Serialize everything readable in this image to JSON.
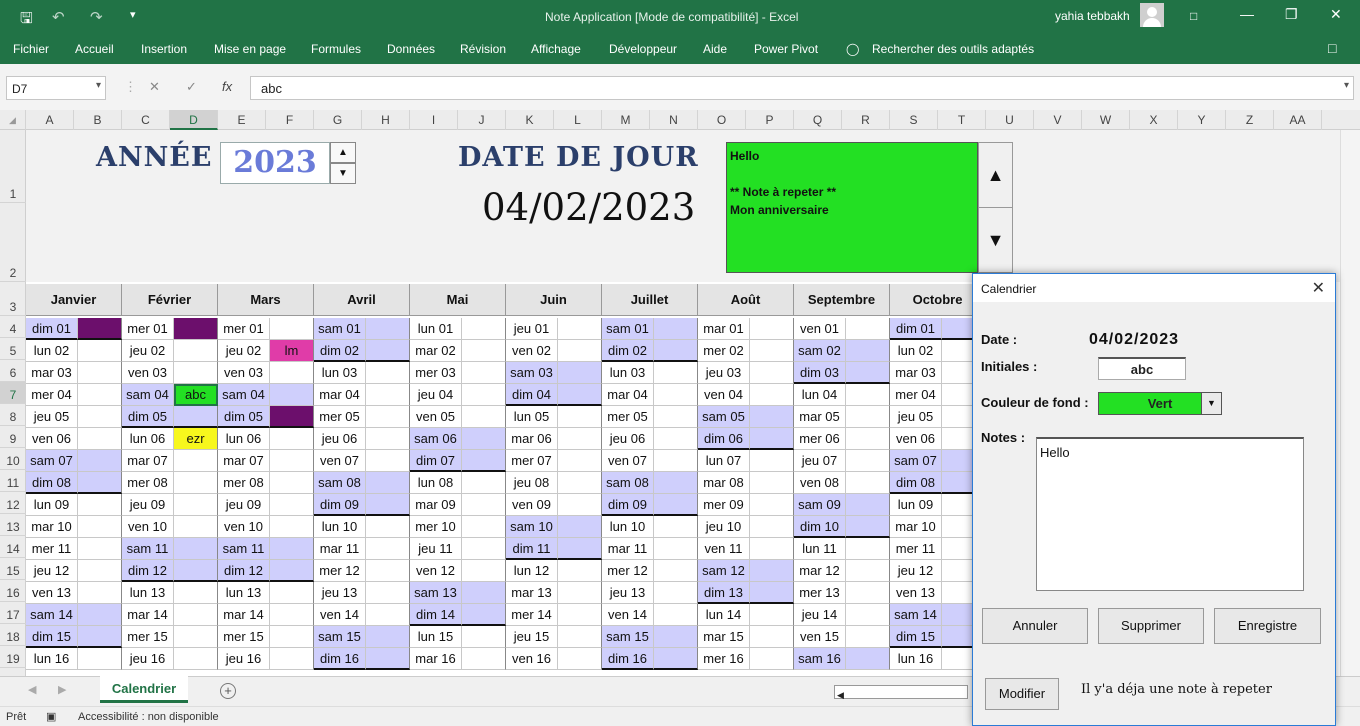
{
  "window": {
    "title": "Note Application  [Mode de compatibilité]  -  Excel",
    "user": "yahia tebbakh"
  },
  "ribbon": {
    "tabs": [
      "Fichier",
      "Accueil",
      "Insertion",
      "Mise en page",
      "Formules",
      "Données",
      "Révision",
      "Affichage",
      "Développeur",
      "Aide",
      "Power Pivot"
    ],
    "search": "Rechercher des outils adaptés"
  },
  "formula_bar": {
    "name_box": "D7",
    "fx": "fx",
    "value": "abc"
  },
  "columns": [
    "A",
    "B",
    "C",
    "D",
    "E",
    "F",
    "G",
    "H",
    "I",
    "J",
    "K",
    "L",
    "M",
    "N",
    "O",
    "P",
    "Q",
    "R",
    "S",
    "T",
    "U",
    "V",
    "W",
    "X",
    "Y",
    "Z",
    "AA"
  ],
  "rows": [
    "1",
    "2",
    "3",
    "4",
    "5",
    "6",
    "7",
    "8",
    "9",
    "10",
    "11",
    "12",
    "13",
    "14",
    "15",
    "16",
    "17",
    "18",
    "19"
  ],
  "header": {
    "annee_label": "ANNÉE",
    "annee_value": "2023",
    "date_label": "DATE DE JOUR",
    "date_value": "04/02/2023",
    "notes_panel": [
      "Hello",
      "",
      "** Note à repeter **",
      "Mon anniversaire"
    ]
  },
  "calendar": {
    "months": [
      "Janvier",
      "Février",
      "Mars",
      "Avril",
      "Mai",
      "Juin",
      "Juillet",
      "Août",
      "Septembre",
      "Octobre"
    ],
    "days": [
      [
        "dim 01",
        "lun 02",
        "mar 03",
        "mer 04",
        "jeu 05",
        "ven 06",
        "sam 07",
        "dim 08",
        "lun 09",
        "mar 10",
        "mer 11",
        "jeu 12",
        "ven 13",
        "sam 14",
        "dim 15",
        "lun 16"
      ],
      [
        "mer 01",
        "jeu 02",
        "ven 03",
        "sam 04",
        "dim 05",
        "lun 06",
        "mar 07",
        "mer 08",
        "jeu 09",
        "ven 10",
        "sam 11",
        "dim 12",
        "lun 13",
        "mar 14",
        "mer 15",
        "jeu 16"
      ],
      [
        "mer 01",
        "jeu 02",
        "ven 03",
        "sam 04",
        "dim 05",
        "lun 06",
        "mar 07",
        "mer 08",
        "jeu 09",
        "ven 10",
        "sam 11",
        "dim 12",
        "lun 13",
        "mar 14",
        "mer 15",
        "jeu 16"
      ],
      [
        "sam 01",
        "dim 02",
        "lun 03",
        "mar 04",
        "mer 05",
        "jeu 06",
        "ven 07",
        "sam 08",
        "dim 09",
        "lun 10",
        "mar 11",
        "mer 12",
        "jeu 13",
        "ven 14",
        "sam 15",
        "dim 16"
      ],
      [
        "lun 01",
        "mar 02",
        "mer 03",
        "jeu 04",
        "ven 05",
        "sam 06",
        "dim 07",
        "lun 08",
        "mar 09",
        "mer 10",
        "jeu 11",
        "ven 12",
        "sam 13",
        "dim 14",
        "lun 15",
        "mar 16"
      ],
      [
        "jeu 01",
        "ven 02",
        "sam 03",
        "dim 04",
        "lun 05",
        "mar 06",
        "mer 07",
        "jeu 08",
        "ven 09",
        "sam 10",
        "dim 11",
        "lun 12",
        "mar 13",
        "mer 14",
        "jeu 15",
        "ven 16"
      ],
      [
        "sam 01",
        "dim 02",
        "lun 03",
        "mar 04",
        "mer 05",
        "jeu 06",
        "ven 07",
        "sam 08",
        "dim 09",
        "lun 10",
        "mar 11",
        "mer 12",
        "jeu 13",
        "ven 14",
        "sam 15",
        "dim 16"
      ],
      [
        "mar 01",
        "mer 02",
        "jeu 03",
        "ven 04",
        "sam 05",
        "dim 06",
        "lun 07",
        "mar 08",
        "mer 09",
        "jeu 10",
        "ven 11",
        "sam 12",
        "dim 13",
        "lun 14",
        "mar 15",
        "mer 16"
      ],
      [
        "ven 01",
        "sam 02",
        "dim 03",
        "lun 04",
        "mar 05",
        "mer 06",
        "jeu 07",
        "ven 08",
        "sam 09",
        "dim 10",
        "lun 11",
        "mar 12",
        "mer 13",
        "jeu 14",
        "ven 15",
        "sam 16"
      ],
      [
        "dim 01",
        "lun 02",
        "mar 03",
        "mer 04",
        "jeu 05",
        "ven 06",
        "sam 07",
        "dim 08",
        "lun 09",
        "mar 10",
        "mer 11",
        "jeu 12",
        "ven 13",
        "sam 14",
        "dim 15",
        "lun 16"
      ]
    ],
    "notes": [
      {
        "month": 0,
        "day": 0,
        "text": "",
        "color": "#6c0f6c"
      },
      {
        "month": 1,
        "day": 0,
        "text": "",
        "color": "#6c0f6c"
      },
      {
        "month": 2,
        "day": 1,
        "text": "lm",
        "color": "#e03ca8"
      },
      {
        "month": 1,
        "day": 3,
        "text": "abc",
        "color": "#23e023"
      },
      {
        "month": 2,
        "day": 4,
        "text": "",
        "color": "#6c0f6c"
      },
      {
        "month": 1,
        "day": 5,
        "text": "ezr",
        "color": "#f7f71d"
      }
    ]
  },
  "colors": {
    "excel_green": "#217346",
    "weekend": "#cfcffc",
    "note_green": "#23e023"
  },
  "sheet_tabs": [
    "Calendrier"
  ],
  "status": {
    "ready": "Prêt",
    "accessibility": "Accessibilité : non disponible"
  },
  "dialog": {
    "title": "Calendrier",
    "date_label": "Date :",
    "date_value": "04/02/2023",
    "initiales_label": "Initiales :",
    "initiales_value": "abc",
    "couleur_label": "Couleur de fond :",
    "couleur_value": "Vert",
    "notes_label": "Notes :",
    "notes_value": "Hello",
    "btn_annuler": "Annuler",
    "btn_supprimer": "Supprimer",
    "btn_enregistre": "Enregistre",
    "btn_modifier": "Modifier",
    "message": "Il y'a déja une note à repeter"
  },
  "icons": [
    "save-icon",
    "undo-icon",
    "redo-icon",
    "customize-icon",
    "user-avatar",
    "minimize-icon",
    "restore-icon",
    "close-icon",
    "lightbulb-icon",
    "comment-icon",
    "close-icon"
  ]
}
